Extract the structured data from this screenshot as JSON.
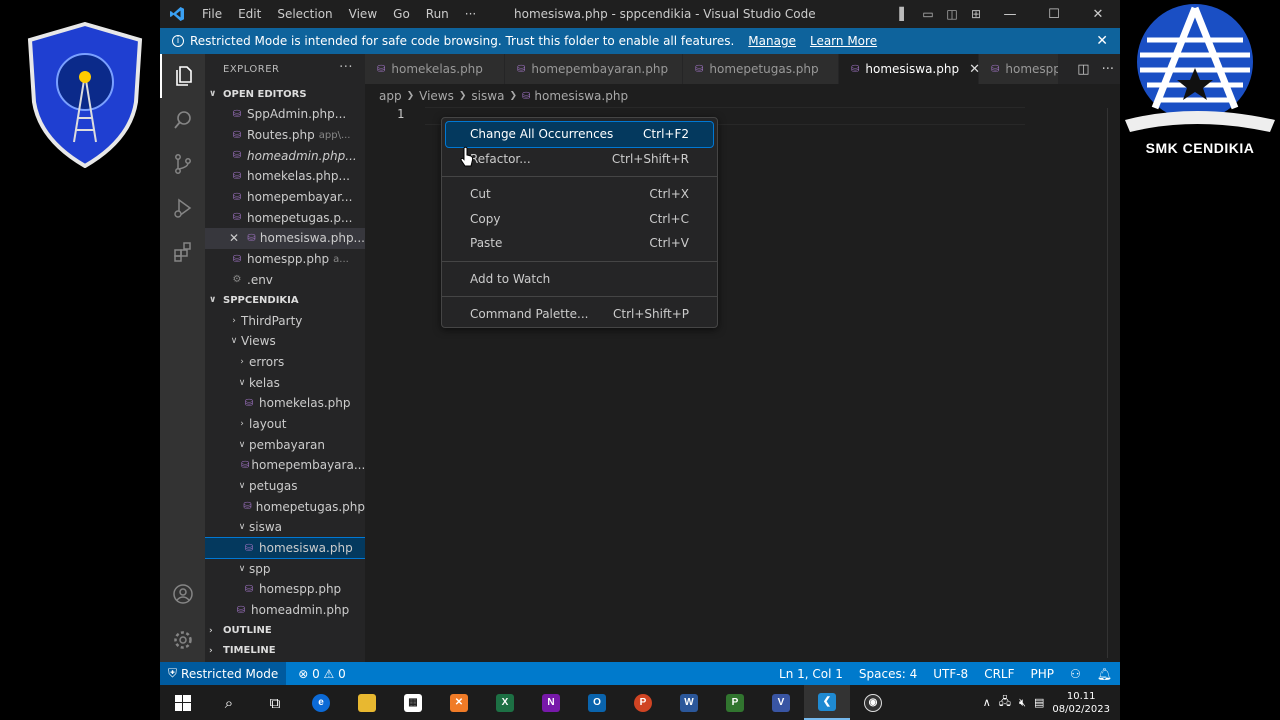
{
  "window": {
    "title": "homesiswa.php - sppcendikia - Visual Studio Code"
  },
  "menu": [
    "File",
    "Edit",
    "Selection",
    "View",
    "Go",
    "Run",
    "···"
  ],
  "banner": {
    "text": "Restricted Mode is intended for safe code browsing. Trust this folder to enable all features.",
    "manage": "Manage",
    "learn_more": "Learn More"
  },
  "explorer": {
    "title": "EXPLORER",
    "open_editors_label": "OPEN EDITORS",
    "open_editors": [
      {
        "name": "SppAdmin.php...",
        "hint": ""
      },
      {
        "name": "Routes.php",
        "hint": "app\\..."
      },
      {
        "name": "homeadmin.php...",
        "hint": ""
      },
      {
        "name": "homekelas.php...",
        "hint": ""
      },
      {
        "name": "homepembayar...",
        "hint": ""
      },
      {
        "name": "homepetugas.p...",
        "hint": ""
      },
      {
        "name": "homesiswa.php...",
        "hint": ""
      },
      {
        "name": "homespp.php",
        "hint": "a..."
      },
      {
        "name": ".env",
        "hint": ""
      }
    ],
    "project_label": "SPPCENDIKIA",
    "tree": [
      "ThirdParty",
      "Views",
      "errors",
      "kelas",
      "homekelas.php",
      "layout",
      "pembayaran",
      "homepembayara...",
      "petugas",
      "homepetugas.php",
      "siswa",
      "homesiswa.php",
      "spp",
      "homespp.php",
      "homeadmin.php"
    ],
    "outline_label": "OUTLINE",
    "timeline_label": "TIMELINE"
  },
  "tabs": [
    "homekelas.php",
    "homepembayaran.php",
    "homepetugas.php",
    "homesiswa.php",
    "homespp..."
  ],
  "breadcrumb": [
    "app",
    "Views",
    "siswa",
    "homesiswa.php"
  ],
  "editor": {
    "line_number": "1"
  },
  "context_menu": [
    {
      "label": "Change All Occurrences",
      "shortcut": "Ctrl+F2"
    },
    {
      "label": "Refactor...",
      "shortcut": "Ctrl+Shift+R"
    },
    {
      "label": "Cut",
      "shortcut": "Ctrl+X"
    },
    {
      "label": "Copy",
      "shortcut": "Ctrl+C"
    },
    {
      "label": "Paste",
      "shortcut": "Ctrl+V"
    },
    {
      "label": "Add to Watch",
      "shortcut": ""
    },
    {
      "label": "Command Palette...",
      "shortcut": "Ctrl+Shift+P"
    }
  ],
  "status": {
    "restricted": "Restricted Mode",
    "problems": "⊗ 0 ⚠ 0",
    "position": "Ln 1, Col 1",
    "spaces": "Spaces: 4",
    "encoding": "UTF-8",
    "eol": "CRLF",
    "language": "PHP"
  },
  "taskbar": {
    "time": "10.11",
    "date": "08/02/2023"
  },
  "branding": {
    "right_text": "SMK CENDIKIA"
  },
  "colors": {
    "accent": "#007acc",
    "banner": "#0e639c",
    "php_icon": "#a074c4"
  }
}
